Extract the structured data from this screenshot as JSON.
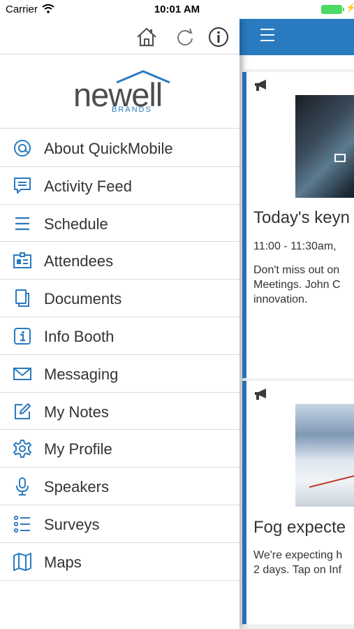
{
  "status_bar": {
    "carrier": "Carrier",
    "time": "10:01 AM"
  },
  "drawer": {
    "toolbar": {
      "icons": [
        "home-icon",
        "refresh-icon",
        "info-icon"
      ]
    },
    "logo": {
      "word": "newell",
      "sub": "BRANDS"
    },
    "menu": [
      {
        "label": "About QuickMobile",
        "icon": "at-target-icon"
      },
      {
        "label": "Activity Feed",
        "icon": "chat-bubble-icon"
      },
      {
        "label": "Schedule",
        "icon": "list-icon"
      },
      {
        "label": "Attendees",
        "icon": "id-card-icon"
      },
      {
        "label": "Documents",
        "icon": "documents-icon"
      },
      {
        "label": "Info Booth",
        "icon": "info-booth-icon"
      },
      {
        "label": "Messaging",
        "icon": "envelope-icon"
      },
      {
        "label": "My Notes",
        "icon": "pencil-note-icon"
      },
      {
        "label": "My Profile",
        "icon": "gear-icon"
      },
      {
        "label": "Speakers",
        "icon": "microphone-icon"
      },
      {
        "label": "Surveys",
        "icon": "survey-list-icon"
      },
      {
        "label": "Maps",
        "icon": "map-icon"
      }
    ]
  },
  "content": {
    "header_icon": "hamburger-menu-icon",
    "cards": [
      {
        "title": "Today's keyn",
        "time": "11:00 - 11:30am,",
        "description": [
          "Don't miss out on",
          "Meetings. John C",
          "innovation."
        ]
      },
      {
        "title": "Fog expecte",
        "description": [
          "We're expecting h",
          "2 days. Tap on Inf"
        ]
      }
    ]
  },
  "colors": {
    "accent": "#2a7ac0",
    "text": "#333333",
    "divider": "#dadada",
    "battery": "#4cd964"
  }
}
